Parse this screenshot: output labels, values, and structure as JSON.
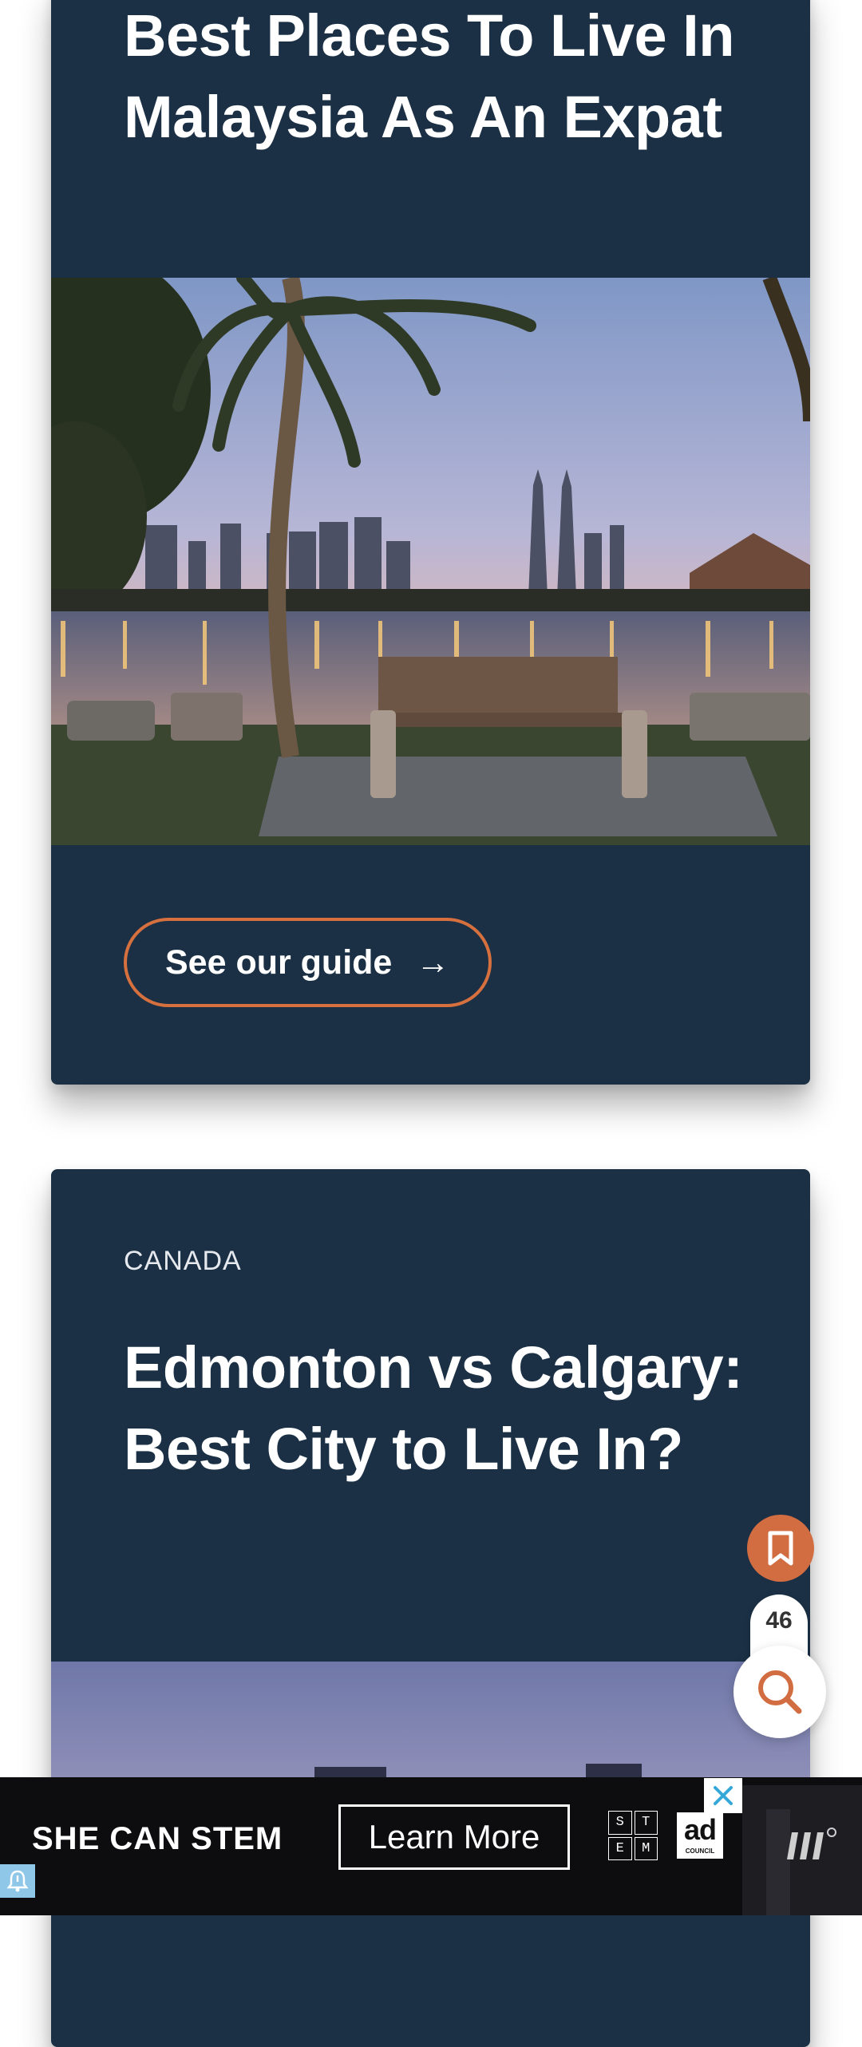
{
  "articles": [
    {
      "category": "",
      "title": "Best Places To Live In Malaysia As An Expat",
      "image": "kuala-lumpur-skyline-lake-bench-palm-photo",
      "cta_label": "See our guide",
      "cta_icon": "arrow-right-icon"
    },
    {
      "category": "CANADA",
      "title": "Edmonton vs Calgary: Best City to Live In?",
      "image": "city-skyline-dusk-photo"
    }
  ],
  "floating": {
    "bookmark_icon": "bookmark-icon",
    "count": "46",
    "search_icon": "search-icon"
  },
  "ad": {
    "headline": "SHE CAN STEM",
    "cta_label": "Learn More",
    "stem_logo_letters": [
      "S",
      "T",
      "E",
      "M"
    ],
    "council_logo_text": "ad",
    "council_logo_sub": "COUNCIL",
    "close_icon": "close-icon",
    "notify_icon": "bell-icon"
  },
  "colors": {
    "card_bg": "#1b3045",
    "accent": "#d26d42",
    "button_border": "#d6703e",
    "ad_bg": "#0d0d10",
    "close_x": "#35a8d8"
  }
}
